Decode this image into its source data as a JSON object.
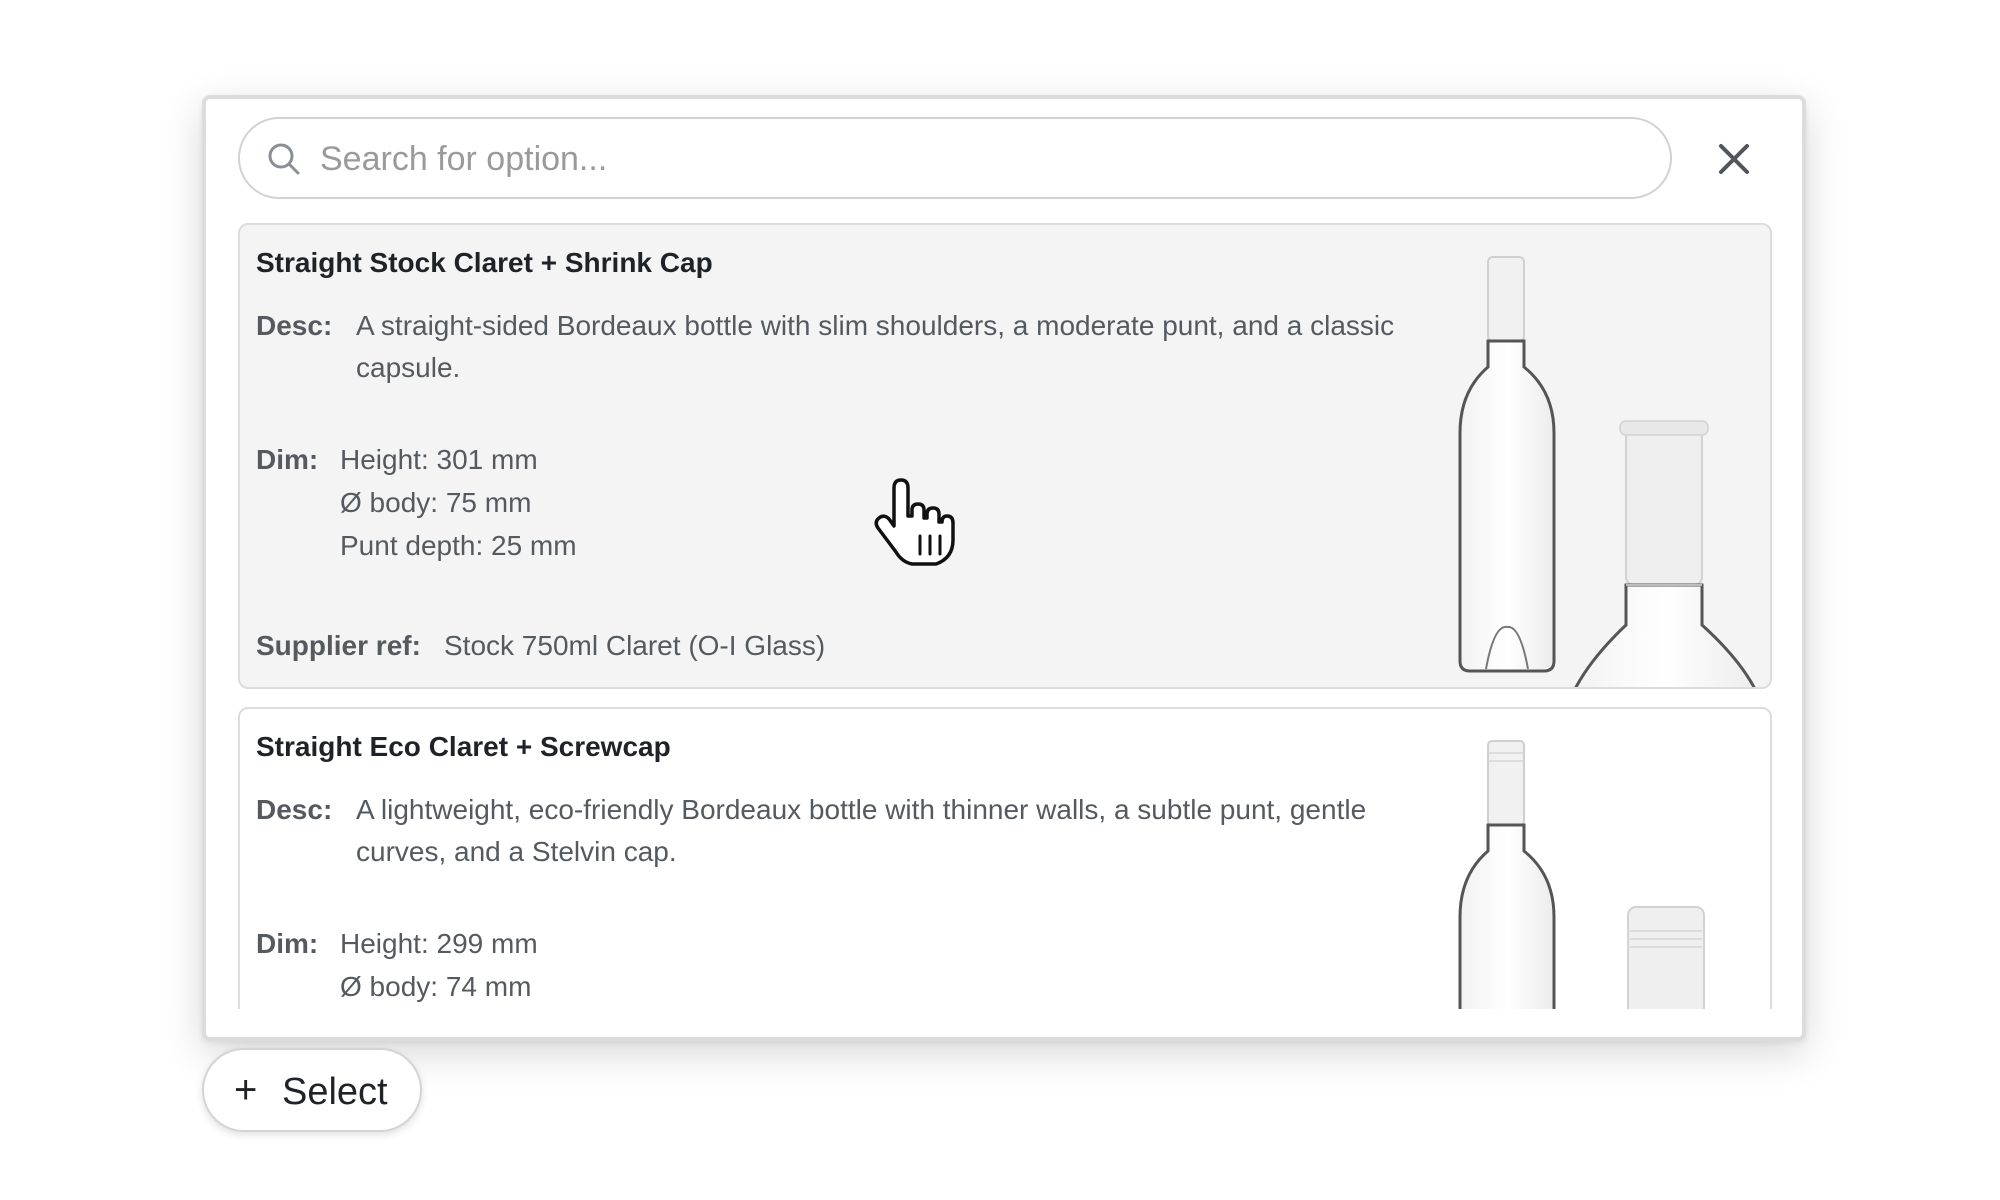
{
  "search": {
    "placeholder": "Search for option...",
    "value": ""
  },
  "options": [
    {
      "title": "Straight Stock Claret + Shrink Cap",
      "desc_label": "Desc:",
      "desc": "A straight-sided Bordeaux bottle with slim shoulders, a moderate punt, and a classic capsule.",
      "dim_label": "Dim:",
      "dims": [
        "Height: 301 mm",
        "Ø body: 75 mm",
        "Punt depth: 25 mm"
      ],
      "ref_label": "Supplier ref:",
      "ref": "Stock 750ml Claret (O-I Glass)"
    },
    {
      "title": "Straight Eco Claret + Screwcap",
      "desc_label": "Desc:",
      "desc": "A lightweight, eco-friendly Bordeaux bottle with thinner walls, a subtle punt, gentle curves, and a Stelvin cap.",
      "dim_label": "Dim:",
      "dims": [
        "Height: 299 mm",
        "Ø body: 74 mm"
      ]
    }
  ],
  "select_button": {
    "icon": "plus-icon",
    "label": "Select"
  },
  "icons": {
    "search": "search-icon",
    "close": "close-icon",
    "cursor": "hand-pointer-cursor-icon",
    "product_image": "wine-bottle-image"
  },
  "colors": {
    "hover_background": "#f4f4f4",
    "border": "#dcdcdc",
    "text_primary": "#1f2328",
    "text_secondary": "#555a60",
    "placeholder": "#9a9a9a"
  }
}
